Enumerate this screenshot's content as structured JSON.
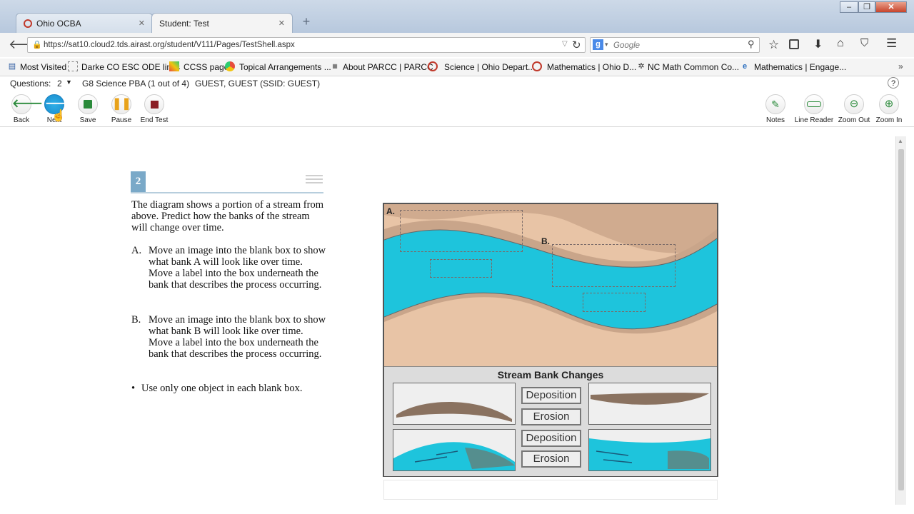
{
  "browser": {
    "tabs": [
      {
        "label": "Ohio OCBA"
      },
      {
        "label": "Student: Test"
      }
    ],
    "url": "https://sat10.cloud2.tds.airast.org/student/V111/Pages/TestShell.aspx",
    "search_engine": "Google",
    "search_placeholder": "Google",
    "bookmarks": [
      {
        "label": "Most Visited"
      },
      {
        "label": "Darke CO ESC ODE links"
      },
      {
        "label": "CCSS page"
      },
      {
        "label": "Topical Arrangements ..."
      },
      {
        "label": "About PARCC | PARCC"
      },
      {
        "label": "Science | Ohio Depart..."
      },
      {
        "label": "Mathematics | Ohio D..."
      },
      {
        "label": "NC Math Common Co..."
      },
      {
        "label": "Mathematics | Engage..."
      }
    ]
  },
  "app": {
    "questions_label": "Questions:",
    "question_select": "2",
    "test_name": "G8 Science PBA (1 out of 4)",
    "student": "GUEST, GUEST (SSID: GUEST)",
    "help": "?",
    "toolbar_left": [
      {
        "label": "Back",
        "icon": "back-arrow-icon"
      },
      {
        "label": "Next",
        "icon": "next-arrow-icon"
      },
      {
        "label": "Save",
        "icon": "save-icon"
      },
      {
        "label": "Pause",
        "icon": "pause-icon"
      },
      {
        "label": "End Test",
        "icon": "stop-icon"
      }
    ],
    "toolbar_right": [
      {
        "label": "Notes",
        "icon": "notes-icon"
      },
      {
        "label": "Line Reader",
        "icon": "line-reader-icon"
      },
      {
        "label": "Zoom Out",
        "icon": "zoom-out-icon"
      },
      {
        "label": "Zoom In",
        "icon": "zoom-in-icon"
      }
    ]
  },
  "question": {
    "number": "2",
    "intro": "The diagram shows a portion of a stream from above. Predict how the banks of the stream will change over time.",
    "part_a_letter": "A.",
    "part_a": "Move an image into the blank box to show what bank A will look like over time. Move a label into the box underneath the bank that describes the process occurring.",
    "part_b_letter": "B.",
    "part_b": "Move an image into the blank box to show what bank B will look like over time. Move a label into the box underneath the bank that describes the process occurring.",
    "bullet": "Use only one object in each blank box."
  },
  "diagram": {
    "label_a": "A.",
    "label_b": "B.",
    "palette_title": "Stream Bank Changes",
    "labels": [
      "Deposition",
      "Erosion",
      "Deposition",
      "Erosion"
    ],
    "colors": {
      "water": "#1ec4dc",
      "bank": "#c9a58a",
      "land": "#e8c4a6",
      "sediment": "#8a7260"
    }
  }
}
